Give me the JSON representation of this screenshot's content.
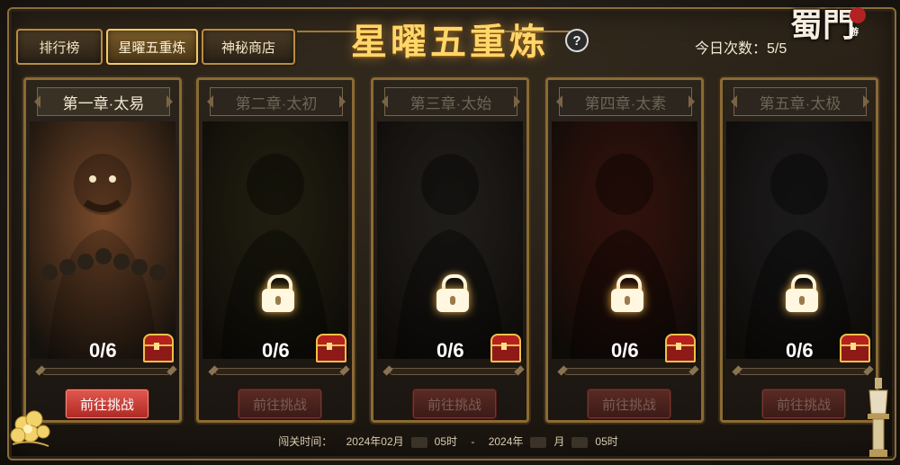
{
  "tabs": [
    {
      "label": "排行榜",
      "active": false
    },
    {
      "label": "星曜五重炼",
      "active": true
    },
    {
      "label": "神秘商店",
      "active": false
    }
  ],
  "title": "星曜五重炼",
  "help_icon": "question-icon",
  "daily": {
    "label": "今日次数：5/5"
  },
  "logo": {
    "text": "蜀門",
    "seal": "手游"
  },
  "chapters": [
    {
      "name": "第一章·太易",
      "progress": "0/6",
      "button": "前往挑战",
      "locked": false,
      "art_color": "#7a4a2a"
    },
    {
      "name": "第二章·太初",
      "progress": "0/6",
      "button": "前往挑战",
      "locked": true,
      "art_color": "#3b3a1a"
    },
    {
      "name": "第三章·太始",
      "progress": "0/6",
      "button": "前往挑战",
      "locked": true,
      "art_color": "#3a3836"
    },
    {
      "name": "第四章·太素",
      "progress": "0/6",
      "button": "前往挑战",
      "locked": true,
      "art_color": "#6a1a10"
    },
    {
      "name": "第五章·太极",
      "progress": "0/6",
      "button": "前往挑战",
      "locked": true,
      "art_color": "#2f3038"
    }
  ],
  "footer": {
    "label": "闯关时间：",
    "start_prefix": "2024年02月",
    "start_suffix": "05时",
    "sep": "-",
    "end_prefix": "2024年",
    "end_mid": "月",
    "end_suffix": "05时"
  }
}
